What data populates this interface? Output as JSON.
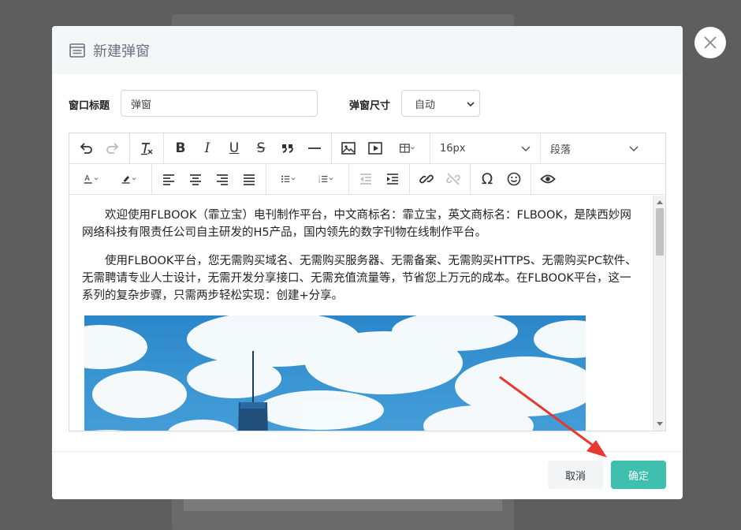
{
  "background": {
    "caption": ""
  },
  "modal": {
    "title": "新建弹窗",
    "title_label": "窗口标题",
    "title_value": "弹窗",
    "size_label": "弹窗尺寸",
    "size_value": "自动",
    "size_options": [
      "自动"
    ]
  },
  "toolbar": {
    "font_size": "16px",
    "block_format": "段落"
  },
  "content": {
    "paragraph1": "欢迎使用FLBOOK（霏立宝）电刊制作平台，中文商标名：霏立宝，英文商标名：FLBOOK，是陕西妙网网络科技有限责任公司自主研发的H5产品，国内领先的数字刊物在线制作平台。",
    "paragraph2": "使用FLBOOK平台，您无需购买域名、无需购买服务器、无需备案、无需购买HTTPS、无需购买PC软件、无需聘请专业人士设计，无需开发分享接口、无需充值流量等，节省您上万元的成本。在FLBOOK平台，这一系列的复杂步骤，只需两步轻松实现：创建+分享。"
  },
  "footer": {
    "cancel_label": "取消",
    "ok_label": "确定"
  },
  "colors": {
    "accent": "#3fbfad",
    "annotation_arrow": "#e8382f"
  }
}
